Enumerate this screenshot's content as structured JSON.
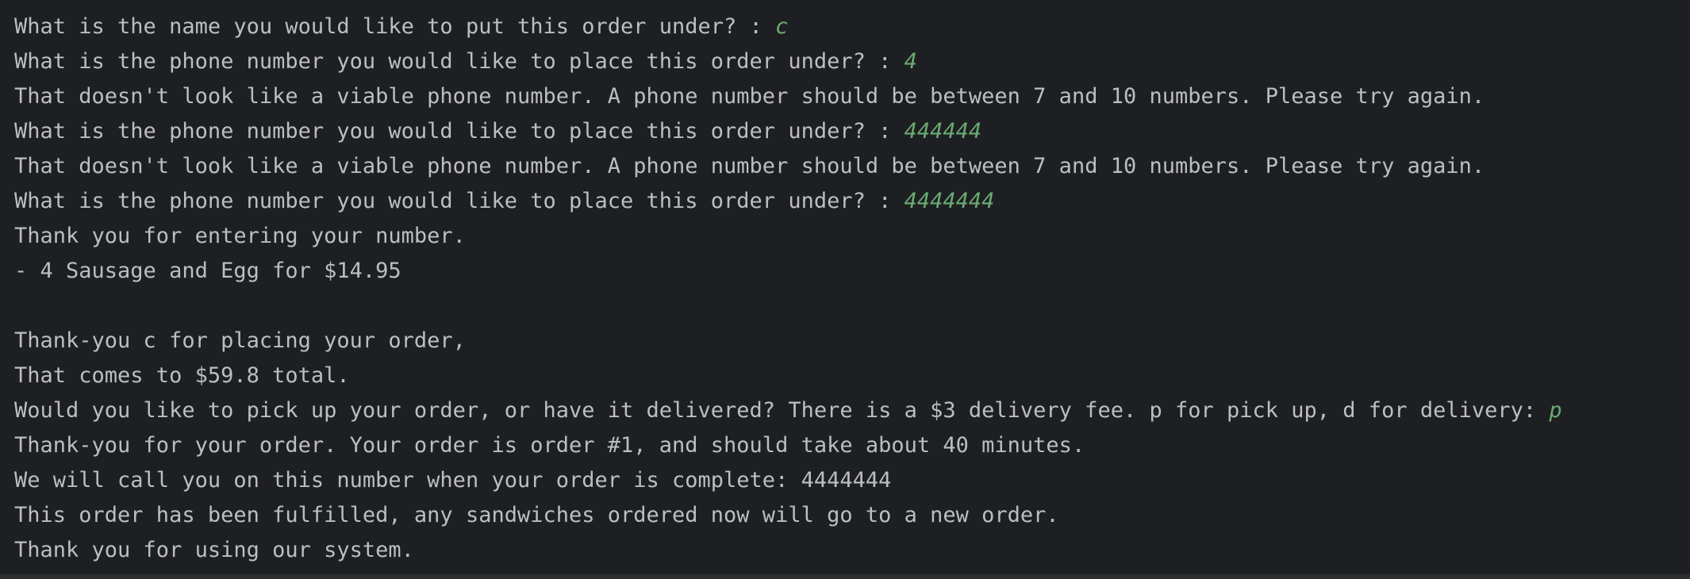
{
  "console": {
    "lines": [
      {
        "text": "What is the name you would like to put this order under? : ",
        "input": "c"
      },
      {
        "text": "What is the phone number you would like to place this order under? : ",
        "input": "4"
      },
      {
        "text": "That doesn't look like a viable phone number. A phone number should be between 7 and 10 numbers. Please try again.",
        "input": ""
      },
      {
        "text": "What is the phone number you would like to place this order under? : ",
        "input": "444444"
      },
      {
        "text": "That doesn't look like a viable phone number. A phone number should be between 7 and 10 numbers. Please try again.",
        "input": ""
      },
      {
        "text": "What is the phone number you would like to place this order under? : ",
        "input": "4444444"
      },
      {
        "text": "Thank you for entering your number.",
        "input": ""
      },
      {
        "text": "- 4 Sausage and Egg for $14.95",
        "input": ""
      },
      {
        "text": "",
        "input": ""
      },
      {
        "text": "Thank-you c for placing your order,",
        "input": ""
      },
      {
        "text": "That comes to $59.8 total.",
        "input": ""
      },
      {
        "text": "Would you like to pick up your order, or have it delivered? There is a $3 delivery fee. p for pick up, d for delivery: ",
        "input": "p"
      },
      {
        "text": "Thank-you for your order. Your order is order #1, and should take about 40 minutes.",
        "input": ""
      },
      {
        "text": "We will call you on this number when your order is complete: 4444444",
        "input": ""
      },
      {
        "text": "This order has been fulfilled, any sandwiches ordered now will go to a new order.",
        "input": ""
      },
      {
        "text": "Thank you for using our system.",
        "input": ""
      }
    ]
  },
  "colors": {
    "background": "#1e1f22",
    "output_text": "#bcbec4",
    "user_input": "#6aab73"
  }
}
